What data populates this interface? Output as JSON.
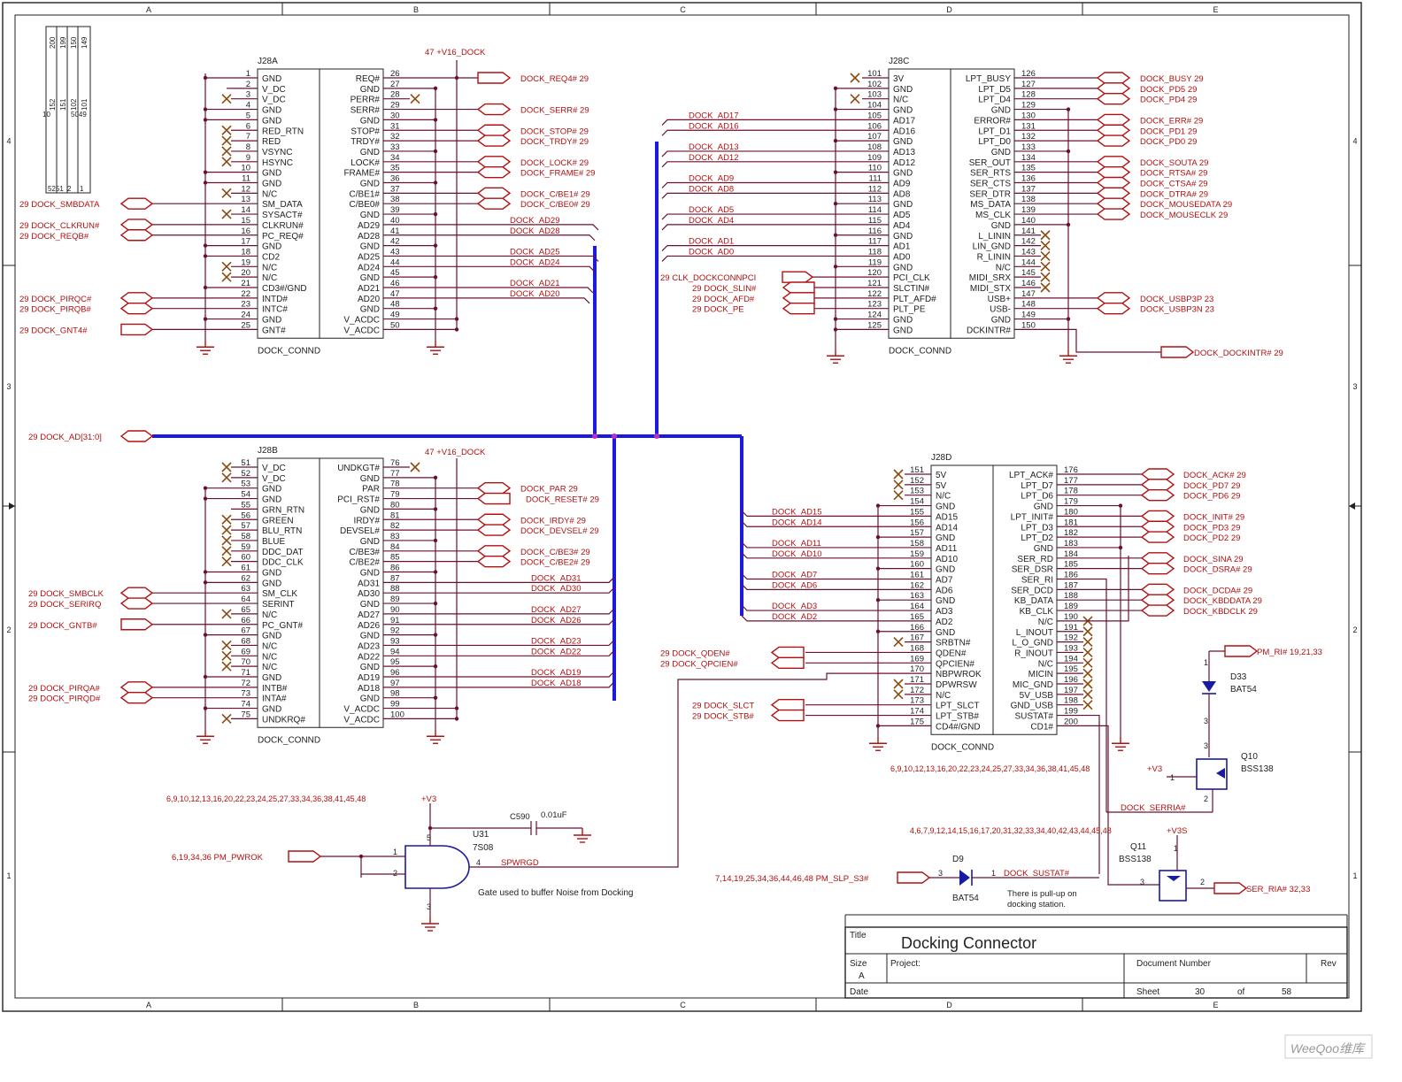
{
  "zones": {
    "cols": [
      "A",
      "B",
      "C",
      "D",
      "E"
    ],
    "rows": [
      "4",
      "3",
      "2",
      "1"
    ]
  },
  "colors": {
    "net": "#b01010",
    "wire": "#6a1030",
    "bus": "#1a1ae0",
    "ink": "#222222"
  },
  "corner_box": {
    "cols": [
      "200",
      "199",
      "150",
      "149"
    ],
    "lines": [
      "152",
      "151",
      "102",
      "101"
    ],
    "left": "10",
    "bottom_left": "5251",
    "bottom_mid": "2",
    "bottom_right": "1",
    "right": "5049"
  },
  "j28a": {
    "ref": "J28A",
    "name": "DOCK_CONND",
    "power": "47  +V16_DOCK",
    "left_pins": [
      [
        "1",
        "GND"
      ],
      [
        "2",
        "V_DC"
      ],
      [
        "3",
        "V_DC"
      ],
      [
        "4",
        "GND"
      ],
      [
        "5",
        "GND"
      ],
      [
        "6",
        "RED_RTN"
      ],
      [
        "7",
        "RED"
      ],
      [
        "8",
        "VSYNC"
      ],
      [
        "9",
        "HSYNC"
      ],
      [
        "10",
        "GND"
      ],
      [
        "11",
        "GND"
      ],
      [
        "12",
        "N/C"
      ],
      [
        "13",
        "SM_DATA"
      ],
      [
        "14",
        "SYSACT#"
      ],
      [
        "15",
        "CLKRUN#"
      ],
      [
        "16",
        "PC_REQ#"
      ],
      [
        "17",
        "GND"
      ],
      [
        "18",
        "CD2"
      ],
      [
        "19",
        "N/C"
      ],
      [
        "20",
        "N/C"
      ],
      [
        "21",
        "CD3#/GND"
      ],
      [
        "22",
        "INTD#"
      ],
      [
        "23",
        "INTC#"
      ],
      [
        "24",
        "GND"
      ],
      [
        "25",
        "GNT#"
      ]
    ],
    "right_pins": [
      [
        "26",
        "REQ#"
      ],
      [
        "27",
        "GND"
      ],
      [
        "28",
        "PERR#"
      ],
      [
        "29",
        "SERR#"
      ],
      [
        "30",
        "GND"
      ],
      [
        "31",
        "STOP#"
      ],
      [
        "32",
        "TRDY#"
      ],
      [
        "33",
        "GND"
      ],
      [
        "34",
        "LOCK#"
      ],
      [
        "35",
        "FRAME#"
      ],
      [
        "36",
        "GND"
      ],
      [
        "37",
        "C/BE1#"
      ],
      [
        "38",
        "C/BE0#"
      ],
      [
        "39",
        "GND"
      ],
      [
        "40",
        "AD29"
      ],
      [
        "41",
        "AD28"
      ],
      [
        "42",
        "GND"
      ],
      [
        "43",
        "AD25"
      ],
      [
        "44",
        "AD24"
      ],
      [
        "45",
        "GND"
      ],
      [
        "46",
        "AD21"
      ],
      [
        "47",
        "AD20"
      ],
      [
        "48",
        "GND"
      ],
      [
        "49",
        "V_ACDC"
      ],
      [
        "50",
        "V_ACDC"
      ]
    ],
    "left_nets": [
      {
        "pin": 13,
        "text": "29  DOCK_SMBDATA"
      },
      {
        "pin": 15,
        "text": "29  DOCK_CLKRUN#"
      },
      {
        "pin": 16,
        "text": "29  DOCK_REQB#"
      },
      {
        "pin": 22,
        "text": "29  DOCK_PIRQC#"
      },
      {
        "pin": 23,
        "text": "29  DOCK_PIRQB#"
      },
      {
        "pin": 25,
        "text": "29  DOCK_GNT4#"
      }
    ],
    "right_nets": [
      {
        "pin": 26,
        "text": "DOCK_REQ4#  29"
      },
      {
        "pin": 29,
        "text": "DOCK_SERR#  29"
      },
      {
        "pin": 31,
        "text": "DOCK_STOP#  29"
      },
      {
        "pin": 32,
        "text": "DOCK_TRDY#  29"
      },
      {
        "pin": 34,
        "text": "DOCK_LOCK#  29"
      },
      {
        "pin": 35,
        "text": "DOCK_FRAME#  29"
      },
      {
        "pin": 37,
        "text": "DOCK_C/BE1#  29"
      },
      {
        "pin": 38,
        "text": "DOCK_C/BE0#  29"
      }
    ],
    "bus_nets": [
      {
        "pin": 40,
        "text": "DOCK_AD29"
      },
      {
        "pin": 41,
        "text": "DOCK_AD28"
      },
      {
        "pin": 43,
        "text": "DOCK_AD25"
      },
      {
        "pin": 44,
        "text": "DOCK_AD24"
      },
      {
        "pin": 46,
        "text": "DOCK_AD21"
      },
      {
        "pin": 47,
        "text": "DOCK_AD20"
      }
    ]
  },
  "j28b": {
    "ref": "J28B",
    "name": "DOCK_CONND",
    "power": "47  +V16_DOCK",
    "left_pins": [
      [
        "51",
        "V_DC"
      ],
      [
        "52",
        "V_DC"
      ],
      [
        "53",
        "GND"
      ],
      [
        "54",
        "GND"
      ],
      [
        "55",
        "GRN_RTN"
      ],
      [
        "56",
        "GREEN"
      ],
      [
        "57",
        "BLU_RTN"
      ],
      [
        "58",
        "BLUE"
      ],
      [
        "59",
        "DDC_DAT"
      ],
      [
        "60",
        "DDC_CLK"
      ],
      [
        "61",
        "GND"
      ],
      [
        "62",
        "GND"
      ],
      [
        "63",
        "SM_CLK"
      ],
      [
        "64",
        "SERINT"
      ],
      [
        "65",
        "N/C"
      ],
      [
        "66",
        "PC_GNT#"
      ],
      [
        "67",
        "GND"
      ],
      [
        "68",
        "N/C"
      ],
      [
        "69",
        "N/C"
      ],
      [
        "70",
        "N/C"
      ],
      [
        "71",
        "GND"
      ],
      [
        "72",
        "INTB#"
      ],
      [
        "73",
        "INTA#"
      ],
      [
        "74",
        "GND"
      ],
      [
        "75",
        "UNDKRQ#"
      ]
    ],
    "right_pins": [
      [
        "76",
        "UNDKGT#"
      ],
      [
        "77",
        "GND"
      ],
      [
        "78",
        "PAR"
      ],
      [
        "79",
        "PCI_RST#"
      ],
      [
        "80",
        "GND"
      ],
      [
        "81",
        "IRDY#"
      ],
      [
        "82",
        "DEVSEL#"
      ],
      [
        "83",
        "GND"
      ],
      [
        "84",
        "C/BE3#"
      ],
      [
        "85",
        "C/BE2#"
      ],
      [
        "86",
        "GND"
      ],
      [
        "87",
        "AD31"
      ],
      [
        "88",
        "AD30"
      ],
      [
        "89",
        "GND"
      ],
      [
        "90",
        "AD27"
      ],
      [
        "91",
        "AD26"
      ],
      [
        "92",
        "GND"
      ],
      [
        "93",
        "AD23"
      ],
      [
        "94",
        "AD22"
      ],
      [
        "95",
        "GND"
      ],
      [
        "96",
        "AD19"
      ],
      [
        "97",
        "AD18"
      ],
      [
        "98",
        "GND"
      ],
      [
        "99",
        "V_ACDC"
      ],
      [
        "100",
        "V_ACDC"
      ]
    ],
    "left_nets": [
      {
        "pin": 63,
        "text": "29  DOCK_SMBCLK"
      },
      {
        "pin": 64,
        "text": "29  DOCK_SERIRQ"
      },
      {
        "pin": 66,
        "text": "29  DOCK_GNTB#"
      },
      {
        "pin": 72,
        "text": "29  DOCK_PIRQA#"
      },
      {
        "pin": 73,
        "text": "29  DOCK_PIRQD#"
      }
    ],
    "right_nets": [
      {
        "pin": 78,
        "text": "DOCK_PAR  29"
      },
      {
        "pin": 79,
        "text": "DOCK_RESET#  29"
      },
      {
        "pin": 81,
        "text": "DOCK_IRDY#  29"
      },
      {
        "pin": 82,
        "text": "DOCK_DEVSEL#  29"
      },
      {
        "pin": 84,
        "text": "DOCK_C/BE3#  29"
      },
      {
        "pin": 85,
        "text": "DOCK_C/BE2#  29"
      }
    ],
    "bus_nets": [
      {
        "pin": 87,
        "text": "DOCK_AD31"
      },
      {
        "pin": 88,
        "text": "DOCK_AD30"
      },
      {
        "pin": 90,
        "text": "DOCK_AD27"
      },
      {
        "pin": 91,
        "text": "DOCK_AD26"
      },
      {
        "pin": 93,
        "text": "DOCK_AD23"
      },
      {
        "pin": 94,
        "text": "DOCK_AD22"
      },
      {
        "pin": 96,
        "text": "DOCK_AD19"
      },
      {
        "pin": 97,
        "text": "DOCK_AD18"
      }
    ]
  },
  "j28c": {
    "ref": "J28C",
    "name": "DOCK_CONND",
    "left_pins": [
      [
        "101",
        "3V"
      ],
      [
        "102",
        "GND"
      ],
      [
        "103",
        "N/C"
      ],
      [
        "104",
        "GND"
      ],
      [
        "105",
        "AD17"
      ],
      [
        "106",
        "AD16"
      ],
      [
        "107",
        "GND"
      ],
      [
        "108",
        "AD13"
      ],
      [
        "109",
        "AD12"
      ],
      [
        "110",
        "GND"
      ],
      [
        "111",
        "AD9"
      ],
      [
        "112",
        "AD8"
      ],
      [
        "113",
        "GND"
      ],
      [
        "114",
        "AD5"
      ],
      [
        "115",
        "AD4"
      ],
      [
        "116",
        "GND"
      ],
      [
        "117",
        "AD1"
      ],
      [
        "118",
        "AD0"
      ],
      [
        "119",
        "GND"
      ],
      [
        "120",
        "PCI_CLK"
      ],
      [
        "121",
        "SLCTIN#"
      ],
      [
        "122",
        "PLT_AFD#"
      ],
      [
        "123",
        "PLT_PE"
      ],
      [
        "124",
        "GND"
      ],
      [
        "125",
        "GND"
      ]
    ],
    "right_pins": [
      [
        "126",
        "LPT_BUSY"
      ],
      [
        "127",
        "LPT_D5"
      ],
      [
        "128",
        "LPT_D4"
      ],
      [
        "129",
        "GND"
      ],
      [
        "130",
        "ERROR#"
      ],
      [
        "131",
        "LPT_D1"
      ],
      [
        "132",
        "LPT_D0"
      ],
      [
        "133",
        "GND"
      ],
      [
        "134",
        "SER_OUT"
      ],
      [
        "135",
        "SER_RTS"
      ],
      [
        "136",
        "SER_CTS"
      ],
      [
        "137",
        "SER_DTR"
      ],
      [
        "138",
        "MS_DATA"
      ],
      [
        "139",
        "MS_CLK"
      ],
      [
        "140",
        "GND"
      ],
      [
        "141",
        "L_LININ"
      ],
      [
        "142",
        "LIN_GND"
      ],
      [
        "143",
        "R_LININ"
      ],
      [
        "144",
        "N/C"
      ],
      [
        "145",
        "MIDI_SRX"
      ],
      [
        "146",
        "MIDI_STX"
      ],
      [
        "147",
        "USB+"
      ],
      [
        "148",
        "USB-"
      ],
      [
        "149",
        "GND"
      ],
      [
        "150",
        "DCKINTR#"
      ]
    ],
    "left_nets": [
      {
        "pin": 120,
        "text": "29  CLK_DOCKCONNPCI"
      },
      {
        "pin": 121,
        "text": "29  DOCK_SLIN#"
      },
      {
        "pin": 122,
        "text": "29  DOCK_AFD#"
      },
      {
        "pin": 123,
        "text": "29  DOCK_PE"
      }
    ],
    "right_nets": [
      {
        "pin": 126,
        "text": "DOCK_BUSY  29"
      },
      {
        "pin": 127,
        "text": "DOCK_PD5  29"
      },
      {
        "pin": 128,
        "text": "DOCK_PD4  29"
      },
      {
        "pin": 130,
        "text": "DOCK_ERR#  29"
      },
      {
        "pin": 131,
        "text": "DOCK_PD1  29"
      },
      {
        "pin": 132,
        "text": "DOCK_PD0  29"
      },
      {
        "pin": 134,
        "text": "DOCK_SOUTA  29"
      },
      {
        "pin": 135,
        "text": "DOCK_RTSA#  29"
      },
      {
        "pin": 136,
        "text": "DOCK_CTSA#  29"
      },
      {
        "pin": 137,
        "text": "DOCK_DTRA#  29"
      },
      {
        "pin": 138,
        "text": "DOCK_MOUSEDATA  29"
      },
      {
        "pin": 139,
        "text": "DOCK_MOUSECLK  29"
      },
      {
        "pin": 147,
        "text": "DOCK_USBP3P  23"
      },
      {
        "pin": 148,
        "text": "DOCK_USBP3N  23"
      }
    ],
    "bus_nets": [
      {
        "pin": 105,
        "text": "DOCK_AD17"
      },
      {
        "pin": 106,
        "text": "DOCK_AD16"
      },
      {
        "pin": 108,
        "text": "DOCK_AD13"
      },
      {
        "pin": 109,
        "text": "DOCK_AD12"
      },
      {
        "pin": 111,
        "text": "DOCK_AD9"
      },
      {
        "pin": 112,
        "text": "DOCK_AD8"
      },
      {
        "pin": 114,
        "text": "DOCK_AD5"
      },
      {
        "pin": 115,
        "text": "DOCK_AD4"
      },
      {
        "pin": 117,
        "text": "DOCK_AD1"
      },
      {
        "pin": 118,
        "text": "DOCK_AD0"
      }
    ],
    "intr": "DOCK_DOCKINTR#  29"
  },
  "j28d": {
    "ref": "J28D",
    "name": "DOCK_CONND",
    "pullup_refs": "6,9,10,12,13,16,20,22,23,24,25,27,33,34,36,38,41,45,48",
    "left_pins": [
      [
        "151",
        "5V"
      ],
      [
        "152",
        "5V"
      ],
      [
        "153",
        "N/C"
      ],
      [
        "154",
        "GND"
      ],
      [
        "155",
        "AD15"
      ],
      [
        "156",
        "AD14"
      ],
      [
        "157",
        "GND"
      ],
      [
        "158",
        "AD11"
      ],
      [
        "159",
        "AD10"
      ],
      [
        "160",
        "GND"
      ],
      [
        "161",
        "AD7"
      ],
      [
        "162",
        "AD6"
      ],
      [
        "163",
        "GND"
      ],
      [
        "164",
        "AD3"
      ],
      [
        "165",
        "AD2"
      ],
      [
        "166",
        "GND"
      ],
      [
        "167",
        "SRBTN#"
      ],
      [
        "168",
        "QDEN#"
      ],
      [
        "169",
        "QPCIEN#"
      ],
      [
        "170",
        "NBPWROK"
      ],
      [
        "171",
        "DPWRSW"
      ],
      [
        "172",
        "N/C"
      ],
      [
        "173",
        "LPT_SLCT"
      ],
      [
        "174",
        "LPT_STB#"
      ],
      [
        "175",
        "CD4#/GND"
      ]
    ],
    "right_pins": [
      [
        "176",
        "LPT_ACK#"
      ],
      [
        "177",
        "LPT_D7"
      ],
      [
        "178",
        "LPT_D6"
      ],
      [
        "179",
        "GND"
      ],
      [
        "180",
        "LPT_INIT#"
      ],
      [
        "181",
        "LPT_D3"
      ],
      [
        "182",
        "LPT_D2"
      ],
      [
        "183",
        "GND"
      ],
      [
        "184",
        "SER_RD"
      ],
      [
        "185",
        "SER_DSR"
      ],
      [
        "186",
        "SER_RI"
      ],
      [
        "187",
        "SER_DCD"
      ],
      [
        "188",
        "KB_DATA"
      ],
      [
        "189",
        "KB_CLK"
      ],
      [
        "190",
        "N/C"
      ],
      [
        "191",
        "L_INOUT"
      ],
      [
        "192",
        "L_O_GND"
      ],
      [
        "193",
        "R_INOUT"
      ],
      [
        "194",
        "N/C"
      ],
      [
        "195",
        "MICIN"
      ],
      [
        "196",
        "MIC_GND"
      ],
      [
        "197",
        "5V_USB"
      ],
      [
        "198",
        "GND_USB"
      ],
      [
        "199",
        "SUSTAT#"
      ],
      [
        "200",
        "CD1#"
      ]
    ],
    "left_nets": [
      {
        "pin": 168,
        "text": "29  DOCK_QDEN#"
      },
      {
        "pin": 169,
        "text": "29  DOCK_QPCIEN#"
      },
      {
        "pin": 173,
        "text": "29  DOCK_SLCT"
      },
      {
        "pin": 174,
        "text": "29  DOCK_STB#"
      }
    ],
    "right_nets": [
      {
        "pin": 176,
        "text": "DOCK_ACK#  29"
      },
      {
        "pin": 177,
        "text": "DOCK_PD7  29"
      },
      {
        "pin": 178,
        "text": "DOCK_PD6  29"
      },
      {
        "pin": 180,
        "text": "DOCK_INIT#  29"
      },
      {
        "pin": 181,
        "text": "DOCK_PD3  29"
      },
      {
        "pin": 182,
        "text": "DOCK_PD2  29"
      },
      {
        "pin": 184,
        "text": "DOCK_SINA  29"
      },
      {
        "pin": 185,
        "text": "DOCK_DSRA#  29"
      },
      {
        "pin": 187,
        "text": "DOCK_DCDA#  29"
      },
      {
        "pin": 188,
        "text": "DOCK_KBDDATA  29"
      },
      {
        "pin": 189,
        "text": "DOCK_KBDCLK  29"
      }
    ],
    "bus_nets": [
      {
        "pin": 155,
        "text": "DOCK_AD15"
      },
      {
        "pin": 156,
        "text": "DOCK_AD14"
      },
      {
        "pin": 158,
        "text": "DOCK_AD11"
      },
      {
        "pin": 159,
        "text": "DOCK_AD10"
      },
      {
        "pin": 161,
        "text": "DOCK_AD7"
      },
      {
        "pin": 162,
        "text": "DOCK_AD6"
      },
      {
        "pin": 164,
        "text": "DOCK_AD3"
      },
      {
        "pin": 165,
        "text": "DOCK_AD2"
      }
    ]
  },
  "bus_label": "29  DOCK_AD[31:0]",
  "u31": {
    "ref": "U31",
    "part": "7S08",
    "pin1": "1",
    "pin2": "2",
    "pin3": "3",
    "pin4": "4",
    "pin5": "5",
    "out": "SPWRGD",
    "in": "6,19,34,36  PM_PWROK",
    "refs": "6,9,10,12,13,16,20,22,23,24,25,27,33,34,36,38,41,45,48",
    "vcc": "+V3",
    "note": "Gate used to buffer Noise from Docking",
    "cap": "C590",
    "cap_val": "0.01uF"
  },
  "d9": {
    "ref": "D9",
    "part": "BAT54",
    "in": "7,14,19,25,34,36,44,46,48    PM_SLP_S3#",
    "pin_a": "3",
    "pin_k": "1",
    "net": "DOCK_SUSTAT#",
    "note1": "There is pull-up on",
    "note2": "docking station."
  },
  "d33": {
    "ref": "D33",
    "part": "BAT54",
    "pin1": "1",
    "pin3": "3",
    "net": "PM_RI#  19,21,33"
  },
  "q10": {
    "ref": "Q10",
    "part": "BSS138",
    "vcc": "+V3",
    "pin1": "1",
    "pin2": "2",
    "pin3": "3",
    "net": "DOCK_SERRIA#"
  },
  "q11": {
    "ref": "Q11",
    "part": "BSS138",
    "vcc": "+V3S",
    "refs": "4,6,7,9,12,14,15,16,17,20,31,32,33,34,40,42,43,44,45,48",
    "pin1": "1",
    "pin2": "2",
    "pin3": "3",
    "net": "SER_RIA#  32,33"
  },
  "title_block": {
    "title_label": "Title",
    "title": "Docking Connector",
    "size_label": "Size",
    "size": "A",
    "project_label": "Project:",
    "doc_label": "Document Number",
    "rev_label": "Rev",
    "date_label": "Date",
    "sheet_label": "Sheet",
    "sheet": "30",
    "of_label": "of",
    "sheets": "58"
  },
  "watermark": "WeeQoo维库"
}
